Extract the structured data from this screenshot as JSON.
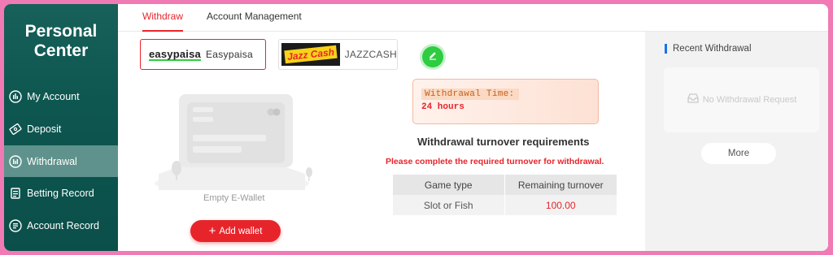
{
  "sidebar": {
    "title_line1": "Personal",
    "title_line2": "Center",
    "items": [
      {
        "label": "My Account",
        "icon": "account-icon"
      },
      {
        "label": "Deposit",
        "icon": "deposit-icon"
      },
      {
        "label": "Withdrawal",
        "icon": "withdrawal-icon",
        "active": true
      },
      {
        "label": "Betting Record",
        "icon": "betting-record-icon"
      },
      {
        "label": "Account Record",
        "icon": "account-record-icon"
      }
    ]
  },
  "tabs": [
    {
      "label": "Withdraw",
      "active": true
    },
    {
      "label": "Account Management"
    }
  ],
  "wallets": [
    {
      "logo": "easypaisa",
      "name": "Easypaisa",
      "selected": true
    },
    {
      "logo": "Jazz Cash",
      "name": "JAZZCASH",
      "selected": false
    }
  ],
  "empty_wallet_text": "Empty E-Wallet",
  "add_wallet_label": "Add wallet",
  "withdrawal_time": {
    "label": "Withdrawal Time:",
    "value": "24 hours"
  },
  "requirements": {
    "title": "Withdrawal turnover requirements",
    "note": "Please complete the required turnover for withdrawal.",
    "headers": [
      "Game type",
      "Remaining turnover"
    ],
    "rows": [
      [
        "Slot or Fish",
        "100.00"
      ]
    ]
  },
  "recent": {
    "title": "Recent Withdrawal",
    "empty": "No Withdrawal Request",
    "more_label": "More"
  },
  "colors": {
    "accent": "#e8242b",
    "sidebar": "#0e5650",
    "sidebar_active": "#5f928c",
    "border": "#f07ab4"
  }
}
